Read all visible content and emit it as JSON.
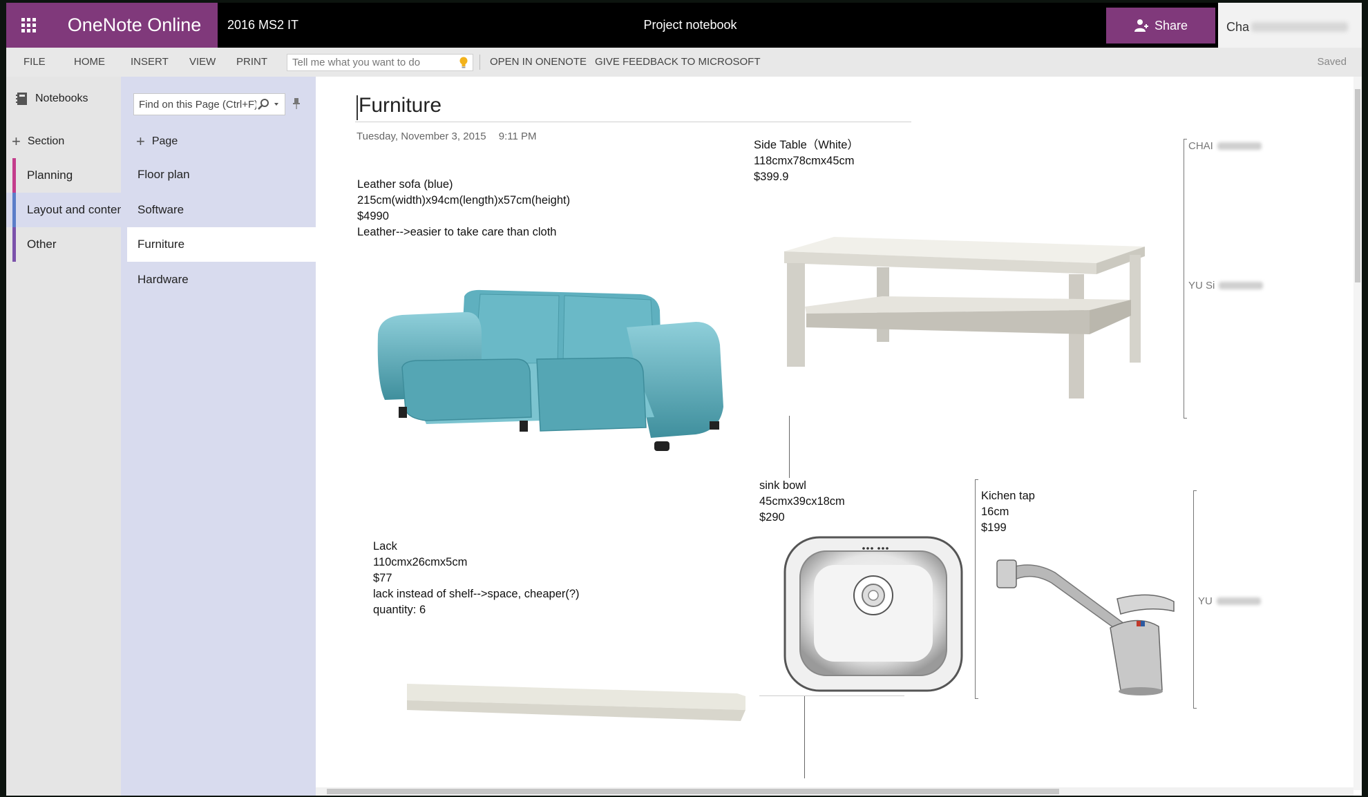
{
  "app": {
    "name": "OneNote Online",
    "notebook": "2016 MS2 IT",
    "document_title": "Project notebook",
    "share_label": "Share",
    "user_name": "Cha"
  },
  "ribbon": {
    "menu": [
      "FILE",
      "HOME",
      "INSERT",
      "VIEW",
      "PRINT"
    ],
    "tell_placeholder": "Tell me what you want to do",
    "open_in_onenote": "OPEN IN ONENOTE",
    "feedback": "GIVE FEEDBACK TO MICROSOFT",
    "status": "Saved"
  },
  "sections_pane": {
    "notebooks_label": "Notebooks",
    "add_section_label": "Section",
    "sections": [
      {
        "label": "Planning",
        "color": "#c43d8c"
      },
      {
        "label": "Layout and content",
        "color": "#5b7ec9"
      },
      {
        "label": "Other",
        "color": "#7b52ab"
      }
    ],
    "selected_section": "Layout and content"
  },
  "pages_pane": {
    "find_placeholder": "Find on this Page (Ctrl+F)",
    "add_page_label": "Page",
    "pages": [
      "Floor plan",
      "Software",
      "Furniture",
      "Hardware"
    ],
    "selected_page": "Furniture"
  },
  "page": {
    "title": "Furniture",
    "date": "Tuesday, November 3, 2015",
    "time": "9:11 PM",
    "notes": {
      "sofa": [
        "Leather sofa (blue)",
        "215cm(width)x94cm(length)x57cm(height)",
        "$4990",
        "Leather-->easier to take care than cloth"
      ],
      "side_table": [
        "Side Table（White）",
        "118cmx78cmx45cm",
        "$399.9"
      ],
      "sink": [
        "sink bowl",
        "45cmx39cx18cm",
        "$290"
      ],
      "tap": [
        "Kichen tap",
        "16cm",
        "$199"
      ],
      "lack": [
        "Lack",
        "110cmx26cmx5cm",
        "$77",
        "lack instead of shelf-->space, cheaper(?)",
        "quantity: 6"
      ]
    },
    "authors": [
      "CHAI",
      "YU Si",
      "YU"
    ]
  },
  "icons": {
    "waffle": "app-launcher-icon",
    "share": "add-person-icon",
    "bulb": "lightbulb-icon",
    "notebooks": "notebook-icon",
    "find": "search-icon",
    "pin": "pin-icon"
  },
  "colors": {
    "brand": "#80397b",
    "topbar": "#000000",
    "pages_pane": "#d8dbee",
    "sections_pane": "#e5e5e5"
  }
}
